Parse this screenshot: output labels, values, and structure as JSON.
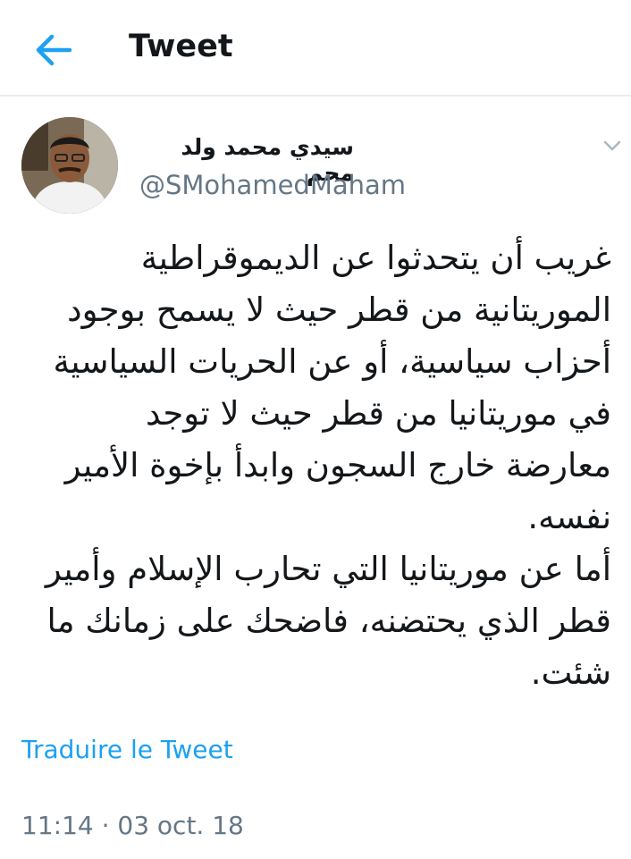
{
  "header": {
    "title": "Tweet",
    "back_icon": "arrow-left-icon"
  },
  "tweet": {
    "author": {
      "display_name": "سيدي محمد ولد محم",
      "handle": "@SMohamedMaham"
    },
    "menu_icon": "chevron-down-icon",
    "text": "غريب أن يتحدثوا عن الديموقراطية\nالموريتانية من قطر حيث لا يسمح بوجود\nأحزاب سياسية، أو عن الحريات السياسية\nفي موريتانيا من قطر حيث لا توجد\nمعارضة خارج السجون وابدأ بإخوة الأمير\nنفسه.\nأما عن موريتانيا التي تحارب الإسلام وأمير\nقطر الذي يحتضنه، فاضحك على زمانك ما\nشئت.",
    "translate_label": "Traduire le Tweet",
    "timestamp": "11:14 · 03 oct. 18"
  },
  "colors": {
    "accent": "#1da1f2",
    "secondary_text": "#657786",
    "divider": "#e6ecf0"
  }
}
